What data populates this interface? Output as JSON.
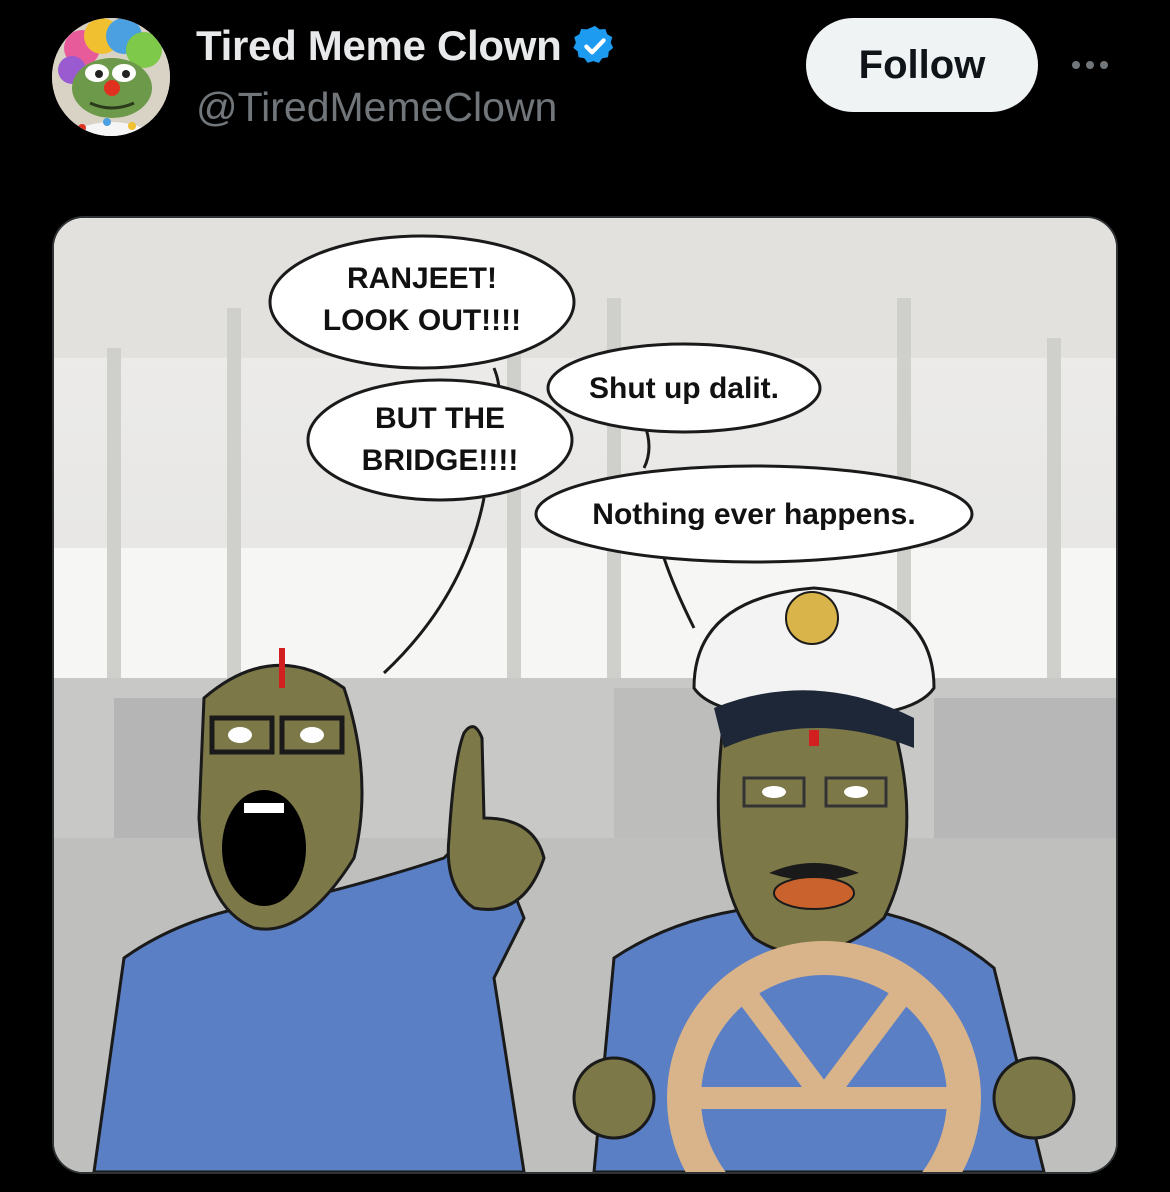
{
  "tweet": {
    "author": {
      "display_name": "Tired Meme Clown",
      "handle": "@TiredMemeClown",
      "verified": true,
      "avatar_icon": "clown-frog-avatar-icon"
    },
    "follow_label": "Follow",
    "more_icon": "more-horizontal-icon",
    "media": {
      "bubbles": {
        "ranjeet_line1": "RANJEET!",
        "ranjeet_line2": "LOOK OUT!!!!",
        "bridge_line1": "BUT THE",
        "bridge_line2": "BRIDGE!!!!",
        "shut_up": "Shut up dalit.",
        "nothing": "Nothing ever happens."
      }
    }
  },
  "colors": {
    "background": "#000000",
    "text_primary": "#e7e9ea",
    "text_secondary": "#71767b",
    "follow_bg": "#eff3f4",
    "verified_blue": "#1d9bf0",
    "shirt_blue": "#5b7fc4",
    "skin": "#7f7a4a",
    "wheel": "#d9b48a"
  }
}
